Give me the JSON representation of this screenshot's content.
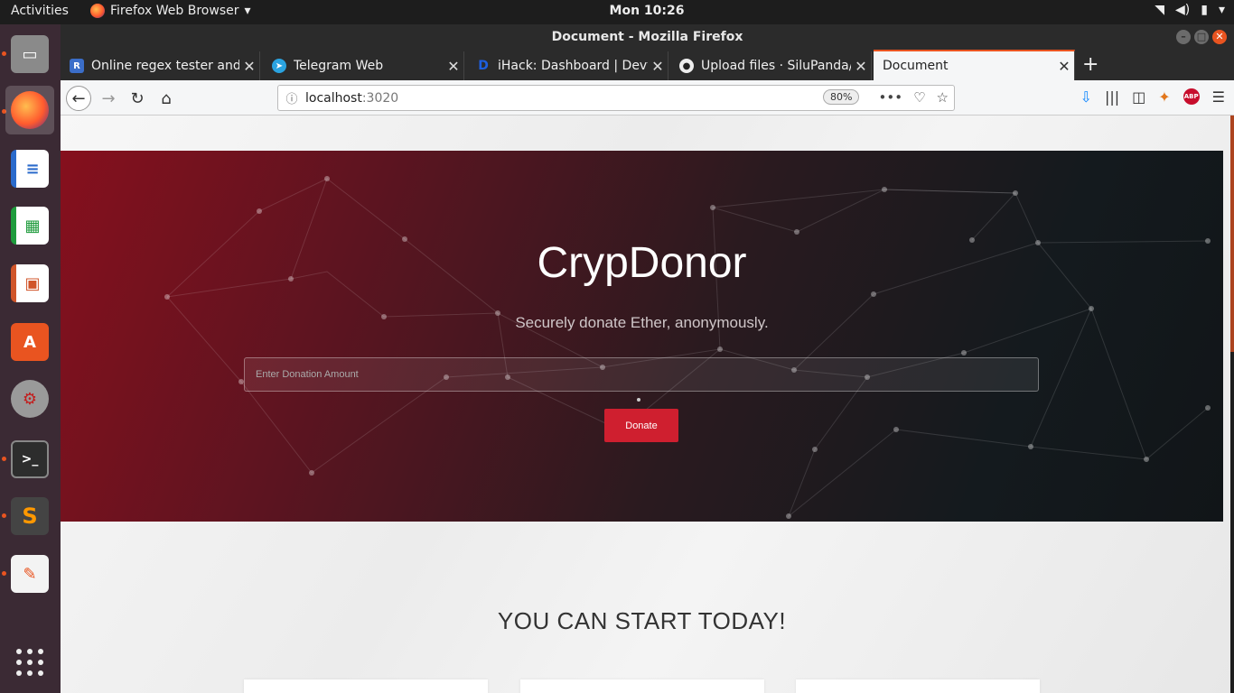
{
  "topbar": {
    "activities": "Activities",
    "app_name": "Firefox Web Browser",
    "clock": "Mon 10:26"
  },
  "dock": {
    "items": [
      "Files",
      "Firefox",
      "LibreOffice Writer",
      "LibreOffice Calc",
      "LibreOffice Impress",
      "Ubuntu Software",
      "System Settings",
      "Terminal",
      "Sublime Text",
      "Text Editor",
      "Show Applications"
    ]
  },
  "window": {
    "title": "Document - Mozilla Firefox"
  },
  "tabs": [
    {
      "title": "Online regex tester and d",
      "favicon_text": "R",
      "favicon_color": "#3b6ec9"
    },
    {
      "title": "Telegram Web",
      "favicon_text": "➤",
      "favicon_color": "#2aa3e0"
    },
    {
      "title": "iHack: Dashboard | Devfo",
      "favicon_text": "D",
      "favicon_color": "#1d5fe0"
    },
    {
      "title": "Upload files · SiluPanda/",
      "favicon_text": "●",
      "favicon_color": "#222222"
    },
    {
      "title": "Document",
      "favicon_text": "",
      "favicon_color": "transparent"
    }
  ],
  "urlbar": {
    "host": "localhost",
    "port": ":3020",
    "zoom": "80%"
  },
  "page": {
    "hero_title": "CrypDonor",
    "hero_subtitle": "Securely donate Ether, anonymously.",
    "donation_placeholder": "Enter Donation Amount",
    "donate_label": "Donate",
    "section_title": "YOU CAN START TODAY!"
  },
  "colors": {
    "accent": "#e95420",
    "donate_button": "#cf1f2f",
    "hero_red": "#86101d",
    "hero_dark": "#111518"
  }
}
